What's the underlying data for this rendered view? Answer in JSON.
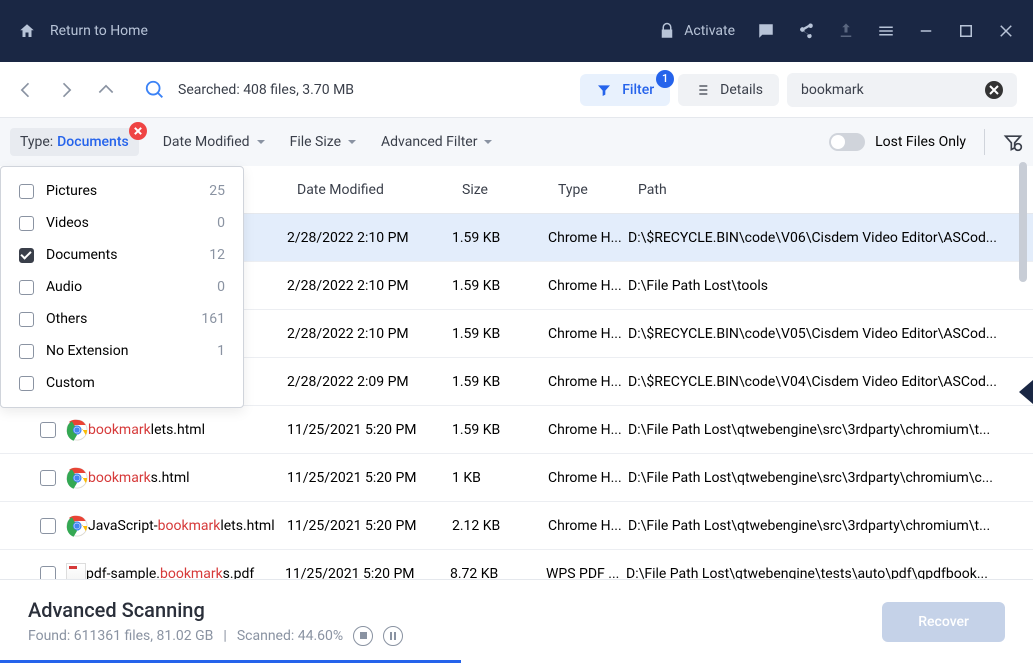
{
  "titlebar": {
    "return": "Return to Home",
    "activate": "Activate"
  },
  "toolbar": {
    "searched": "Searched: 408 files, 3.70 MB",
    "filter": "Filter",
    "filter_badge": "1",
    "details": "Details",
    "search_val": "bookmark"
  },
  "filterbar": {
    "type_label": "Type:",
    "type_val": "Documents",
    "date": "Date Modified",
    "size": "File Size",
    "adv": "Advanced Filter",
    "lost": "Lost Files Only"
  },
  "dropdown": [
    {
      "label": "Pictures",
      "count": "25",
      "checked": false
    },
    {
      "label": "Videos",
      "count": "0",
      "checked": false
    },
    {
      "label": "Documents",
      "count": "12",
      "checked": true
    },
    {
      "label": "Audio",
      "count": "0",
      "checked": false
    },
    {
      "label": "Others",
      "count": "161",
      "checked": false
    },
    {
      "label": "No Extension",
      "count": "1",
      "checked": false
    },
    {
      "label": "Custom",
      "count": "",
      "checked": false
    }
  ],
  "columns": {
    "date": "Date Modified",
    "size": "Size",
    "type": "Type",
    "path": "Path"
  },
  "rows": [
    {
      "icon": "chrome",
      "name_pre": "",
      "name_hl": "",
      "name_post": "",
      "date": "2/28/2022 2:10 PM",
      "size": "1.59 KB",
      "type": "Chrome H...",
      "path": "D:\\$RECYCLE.BIN\\code\\V06\\Cisdem Video Editor\\ASCod...",
      "selected": true
    },
    {
      "icon": "chrome",
      "name_pre": "",
      "name_hl": "",
      "name_post": "",
      "date": "2/28/2022 2:10 PM",
      "size": "1.59 KB",
      "type": "Chrome H...",
      "path": "D:\\File Path Lost\\tools",
      "selected": false
    },
    {
      "icon": "chrome",
      "name_pre": "",
      "name_hl": "",
      "name_post": "",
      "date": "2/28/2022 2:10 PM",
      "size": "1.59 KB",
      "type": "Chrome H...",
      "path": "D:\\$RECYCLE.BIN\\code\\V05\\Cisdem Video Editor\\ASCod...",
      "selected": false
    },
    {
      "icon": "chrome",
      "name_pre": "",
      "name_hl": "",
      "name_post": "",
      "date": "2/28/2022 2:09 PM",
      "size": "1.59 KB",
      "type": "Chrome H...",
      "path": "D:\\$RECYCLE.BIN\\code\\V04\\Cisdem Video Editor\\ASCod...",
      "selected": false
    },
    {
      "icon": "chrome",
      "name_pre": "",
      "name_hl": "bookmark",
      "name_post": "lets.html",
      "date": "11/25/2021 5:20 PM",
      "size": "1.59 KB",
      "type": "Chrome H...",
      "path": "D:\\File Path Lost\\qtwebengine\\src\\3rdparty\\chromium\\t...",
      "selected": false
    },
    {
      "icon": "chrome",
      "name_pre": "",
      "name_hl": "bookmark",
      "name_post": "s.html",
      "date": "11/25/2021 5:20 PM",
      "size": "1 KB",
      "type": "Chrome H...",
      "path": "D:\\File Path Lost\\qtwebengine\\src\\3rdparty\\chromium\\c...",
      "selected": false
    },
    {
      "icon": "chrome",
      "name_pre": "JavaScript-",
      "name_hl": "bookmark",
      "name_post": "lets.html",
      "date": "11/25/2021 5:20 PM",
      "size": "2.12 KB",
      "type": "Chrome H...",
      "path": "D:\\File Path Lost\\qtwebengine\\src\\3rdparty\\chromium\\t...",
      "selected": false
    },
    {
      "icon": "pdf",
      "name_pre": "pdf-sample.",
      "name_hl": "bookmark",
      "name_post": "s.pdf",
      "date": "11/25/2021 5:20 PM",
      "size": "8.72 KB",
      "type": "WPS PDF ...",
      "path": "D:\\File Path Lost\\qtwebengine\\tests\\auto\\pdf\\qpdfbook...",
      "selected": false
    }
  ],
  "footer": {
    "title": "Advanced Scanning",
    "found": "Found: 611361 files, 81.02 GB",
    "scanned": "Scanned: 44.60%",
    "recover": "Recover",
    "progress": 44.6
  }
}
